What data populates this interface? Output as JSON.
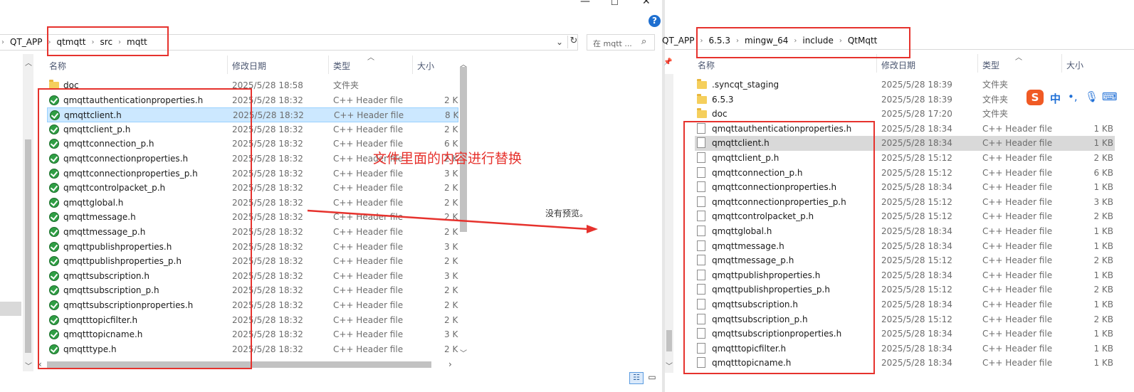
{
  "left": {
    "breadcrumb": [
      "QT_APP",
      "qtmqtt",
      "src",
      "mqtt"
    ],
    "search_placeholder": "在 mqtt ...",
    "columns": {
      "name": "名称",
      "date": "修改日期",
      "type": "类型",
      "size": "大小"
    },
    "files": [
      {
        "name": "doc",
        "date": "2025/5/28 18:58",
        "type": "文件夹",
        "size": "",
        "icon": "folder-icon"
      },
      {
        "name": "qmqttauthenticationproperties.h",
        "date": "2025/5/28 18:32",
        "type": "C++ Header file",
        "size": "2 K",
        "icon": "file-check-icon"
      },
      {
        "name": "qmqttclient.h",
        "date": "2025/5/28 18:32",
        "type": "C++ Header file",
        "size": "8 K",
        "icon": "file-check-icon",
        "selected": true
      },
      {
        "name": "qmqttclient_p.h",
        "date": "2025/5/28 18:32",
        "type": "C++ Header file",
        "size": "2 K",
        "icon": "file-check-icon"
      },
      {
        "name": "qmqttconnection_p.h",
        "date": "2025/5/28 18:32",
        "type": "C++ Header file",
        "size": "6 K",
        "icon": "file-check-icon"
      },
      {
        "name": "qmqttconnectionproperties.h",
        "date": "2025/5/28 18:32",
        "type": "C++ Header file",
        "size": "2 K",
        "icon": "file-check-icon"
      },
      {
        "name": "qmqttconnectionproperties_p.h",
        "date": "2025/5/28 18:32",
        "type": "C++ Header file",
        "size": "3 K",
        "icon": "file-check-icon"
      },
      {
        "name": "qmqttcontrolpacket_p.h",
        "date": "2025/5/28 18:32",
        "type": "C++ Header file",
        "size": "2 K",
        "icon": "file-check-icon"
      },
      {
        "name": "qmqttglobal.h",
        "date": "2025/5/28 18:32",
        "type": "C++ Header file",
        "size": "2 K",
        "icon": "file-check-icon"
      },
      {
        "name": "qmqttmessage.h",
        "date": "2025/5/28 18:32",
        "type": "C++ Header file",
        "size": "2 K",
        "icon": "file-check-icon"
      },
      {
        "name": "qmqttmessage_p.h",
        "date": "2025/5/28 18:32",
        "type": "C++ Header file",
        "size": "2 K",
        "icon": "file-check-icon"
      },
      {
        "name": "qmqttpublishproperties.h",
        "date": "2025/5/28 18:32",
        "type": "C++ Header file",
        "size": "3 K",
        "icon": "file-check-icon"
      },
      {
        "name": "qmqttpublishproperties_p.h",
        "date": "2025/5/28 18:32",
        "type": "C++ Header file",
        "size": "2 K",
        "icon": "file-check-icon"
      },
      {
        "name": "qmqttsubscription.h",
        "date": "2025/5/28 18:32",
        "type": "C++ Header file",
        "size": "3 K",
        "icon": "file-check-icon"
      },
      {
        "name": "qmqttsubscription_p.h",
        "date": "2025/5/28 18:32",
        "type": "C++ Header file",
        "size": "2 K",
        "icon": "file-check-icon"
      },
      {
        "name": "qmqttsubscriptionproperties.h",
        "date": "2025/5/28 18:32",
        "type": "C++ Header file",
        "size": "2 K",
        "icon": "file-check-icon"
      },
      {
        "name": "qmqtttopicfilter.h",
        "date": "2025/5/28 18:32",
        "type": "C++ Header file",
        "size": "2 K",
        "icon": "file-check-icon"
      },
      {
        "name": "qmqtttopicname.h",
        "date": "2025/5/28 18:32",
        "type": "C++ Header file",
        "size": "3 K",
        "icon": "file-check-icon"
      },
      {
        "name": "qmqtttype.h",
        "date": "2025/5/28 18:32",
        "type": "C++ Header file",
        "size": "2 K",
        "icon": "file-check-icon"
      }
    ],
    "no_preview": "没有预览。",
    "annotation": "文件里面的内容进行替换"
  },
  "right": {
    "breadcrumb": [
      "QT_APP",
      "6.5.3",
      "mingw_64",
      "include",
      "QtMqtt"
    ],
    "columns": {
      "name": "名称",
      "date": "修改日期",
      "type": "类型",
      "size": "大小"
    },
    "ime": {
      "logo": "S",
      "lang": "中"
    },
    "files": [
      {
        "name": ".syncqt_staging",
        "date": "2025/5/28 18:39",
        "type": "文件夹",
        "size": "",
        "icon": "folder-icon"
      },
      {
        "name": "6.5.3",
        "date": "2025/5/28 18:39",
        "type": "文件夹",
        "size": "",
        "icon": "folder-icon"
      },
      {
        "name": "doc",
        "date": "2025/5/28 17:20",
        "type": "文件夹",
        "size": "",
        "icon": "folder-icon"
      },
      {
        "name": "qmqttauthenticationproperties.h",
        "date": "2025/5/28 18:34",
        "type": "C++ Header file",
        "size": "1 KB",
        "icon": "file-icon"
      },
      {
        "name": "qmqttclient.h",
        "date": "2025/5/28 18:34",
        "type": "C++ Header file",
        "size": "1 KB",
        "icon": "file-icon",
        "selected": true
      },
      {
        "name": "qmqttclient_p.h",
        "date": "2025/5/28 15:12",
        "type": "C++ Header file",
        "size": "2 KB",
        "icon": "file-icon"
      },
      {
        "name": "qmqttconnection_p.h",
        "date": "2025/5/28 15:12",
        "type": "C++ Header file",
        "size": "6 KB",
        "icon": "file-icon"
      },
      {
        "name": "qmqttconnectionproperties.h",
        "date": "2025/5/28 18:34",
        "type": "C++ Header file",
        "size": "1 KB",
        "icon": "file-icon"
      },
      {
        "name": "qmqttconnectionproperties_p.h",
        "date": "2025/5/28 15:12",
        "type": "C++ Header file",
        "size": "3 KB",
        "icon": "file-icon"
      },
      {
        "name": "qmqttcontrolpacket_p.h",
        "date": "2025/5/28 15:12",
        "type": "C++ Header file",
        "size": "2 KB",
        "icon": "file-icon"
      },
      {
        "name": "qmqttglobal.h",
        "date": "2025/5/28 18:34",
        "type": "C++ Header file",
        "size": "1 KB",
        "icon": "file-icon"
      },
      {
        "name": "qmqttmessage.h",
        "date": "2025/5/28 18:34",
        "type": "C++ Header file",
        "size": "1 KB",
        "icon": "file-icon"
      },
      {
        "name": "qmqttmessage_p.h",
        "date": "2025/5/28 15:12",
        "type": "C++ Header file",
        "size": "2 KB",
        "icon": "file-icon"
      },
      {
        "name": "qmqttpublishproperties.h",
        "date": "2025/5/28 18:34",
        "type": "C++ Header file",
        "size": "1 KB",
        "icon": "file-icon"
      },
      {
        "name": "qmqttpublishproperties_p.h",
        "date": "2025/5/28 15:12",
        "type": "C++ Header file",
        "size": "2 KB",
        "icon": "file-icon"
      },
      {
        "name": "qmqttsubscription.h",
        "date": "2025/5/28 18:34",
        "type": "C++ Header file",
        "size": "1 KB",
        "icon": "file-icon"
      },
      {
        "name": "qmqttsubscription_p.h",
        "date": "2025/5/28 15:12",
        "type": "C++ Header file",
        "size": "2 KB",
        "icon": "file-icon"
      },
      {
        "name": "qmqttsubscriptionproperties.h",
        "date": "2025/5/28 18:34",
        "type": "C++ Header file",
        "size": "1 KB",
        "icon": "file-icon"
      },
      {
        "name": "qmqtttopicfilter.h",
        "date": "2025/5/28 18:34",
        "type": "C++ Header file",
        "size": "1 KB",
        "icon": "file-icon"
      },
      {
        "name": "qmqtttopicname.h",
        "date": "2025/5/28 18:34",
        "type": "C++ Header file",
        "size": "1 KB",
        "icon": "file-icon"
      }
    ]
  },
  "colors": {
    "annotation_red": "#e6322d",
    "selection_blue": "#cce8ff",
    "selection_gray": "#d9d9d9"
  }
}
